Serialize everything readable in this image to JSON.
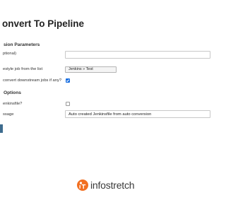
{
  "page": {
    "title": "onvert To Pipeline"
  },
  "sections": {
    "conversion_parameters": "sion Parameters",
    "options": "Options"
  },
  "fields": {
    "optional": {
      "label": "ptional)",
      "value": ""
    },
    "job": {
      "label": "estyle job from the list",
      "selected": "Jenkins » Test"
    },
    "downstream": {
      "label": "convert downstream jobs if any?",
      "checked": true
    },
    "jenkinsfile": {
      "label": "enkinsfile?",
      "checked": false
    },
    "message": {
      "label": "ssage",
      "value": "Auto created Jenkinsfile from auto conversion"
    }
  },
  "footer": {
    "logo_text": "infostretch",
    "logo_color": "#f26f21"
  },
  "colors": {
    "checkbox_accent": "#1a6fe0",
    "button": "#3e6c8e"
  }
}
